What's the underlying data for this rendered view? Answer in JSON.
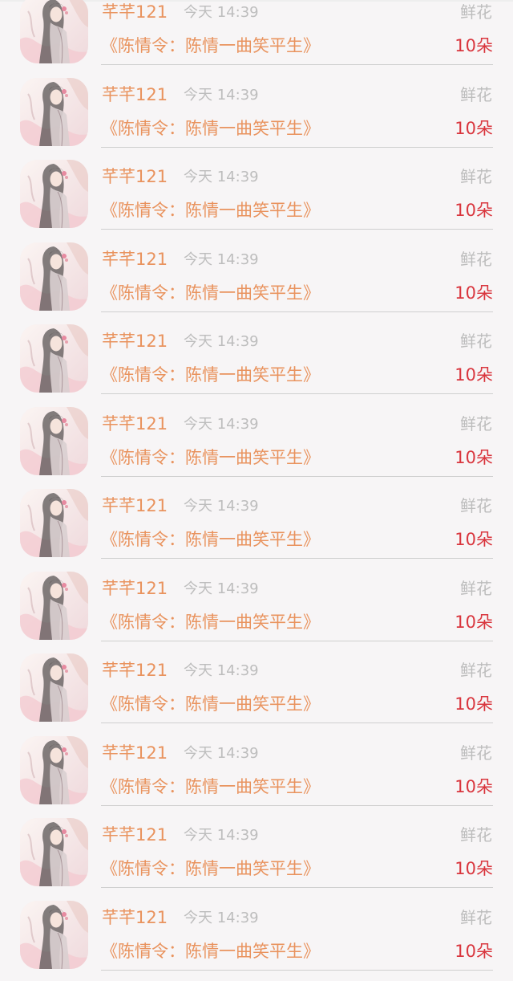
{
  "records": [
    {
      "name": "芊芊121",
      "time": "今天 14:39",
      "gift": "鲜花",
      "title": "《陈情令：陈情一曲笑平生》",
      "count": "10朵",
      "avatar_icon": "opera-portrait-avatar"
    },
    {
      "name": "芊芊121",
      "time": "今天 14:39",
      "gift": "鲜花",
      "title": "《陈情令：陈情一曲笑平生》",
      "count": "10朵",
      "avatar_icon": "opera-portrait-avatar"
    },
    {
      "name": "芊芊121",
      "time": "今天 14:39",
      "gift": "鲜花",
      "title": "《陈情令：陈情一曲笑平生》",
      "count": "10朵",
      "avatar_icon": "opera-portrait-avatar"
    },
    {
      "name": "芊芊121",
      "time": "今天 14:39",
      "gift": "鲜花",
      "title": "《陈情令：陈情一曲笑平生》",
      "count": "10朵",
      "avatar_icon": "opera-portrait-avatar"
    },
    {
      "name": "芊芊121",
      "time": "今天 14:39",
      "gift": "鲜花",
      "title": "《陈情令：陈情一曲笑平生》",
      "count": "10朵",
      "avatar_icon": "opera-portrait-avatar"
    },
    {
      "name": "芊芊121",
      "time": "今天 14:39",
      "gift": "鲜花",
      "title": "《陈情令：陈情一曲笑平生》",
      "count": "10朵",
      "avatar_icon": "opera-portrait-avatar"
    },
    {
      "name": "芊芊121",
      "time": "今天 14:39",
      "gift": "鲜花",
      "title": "《陈情令：陈情一曲笑平生》",
      "count": "10朵",
      "avatar_icon": "opera-portrait-avatar"
    },
    {
      "name": "芊芊121",
      "time": "今天 14:39",
      "gift": "鲜花",
      "title": "《陈情令：陈情一曲笑平生》",
      "count": "10朵",
      "avatar_icon": "opera-portrait-avatar"
    },
    {
      "name": "芊芊121",
      "time": "今天 14:39",
      "gift": "鲜花",
      "title": "《陈情令：陈情一曲笑平生》",
      "count": "10朵",
      "avatar_icon": "opera-portrait-avatar"
    },
    {
      "name": "芊芊121",
      "time": "今天 14:39",
      "gift": "鲜花",
      "title": "《陈情令：陈情一曲笑平生》",
      "count": "10朵",
      "avatar_icon": "opera-portrait-avatar"
    },
    {
      "name": "芊芊121",
      "time": "今天 14:39",
      "gift": "鲜花",
      "title": "《陈情令：陈情一曲笑平生》",
      "count": "10朵",
      "avatar_icon": "opera-portrait-avatar"
    },
    {
      "name": "芊芊121",
      "time": "今天 14:39",
      "gift": "鲜花",
      "title": "《陈情令：陈情一曲笑平生》",
      "count": "10朵",
      "avatar_icon": "opera-portrait-avatar"
    }
  ],
  "colors": {
    "name": "#e9935e",
    "title": "#e9935e",
    "count": "#d9363e",
    "muted": "#bdbdbd",
    "background": "#f7f5f6"
  }
}
